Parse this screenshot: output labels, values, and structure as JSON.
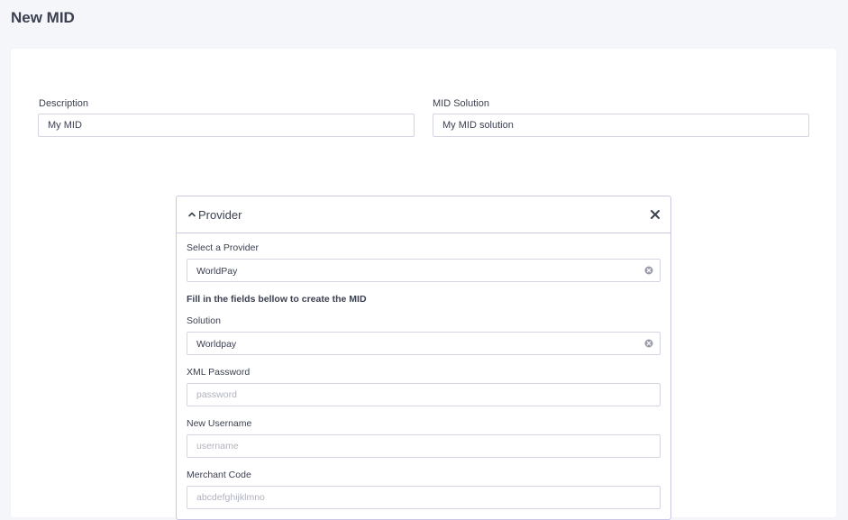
{
  "page": {
    "title": "New MID"
  },
  "form": {
    "description": {
      "label": "Description",
      "value": "My MID"
    },
    "mid_solution": {
      "label": "MID Solution",
      "value": "My MID solution"
    }
  },
  "provider_panel": {
    "title": "Provider",
    "select_provider": {
      "label": "Select a Provider",
      "value": "WorldPay"
    },
    "instructions": "Fill in the fields bellow to create the MID",
    "solution": {
      "label": "Solution",
      "value": "Worldpay"
    },
    "xml_password": {
      "label": "XML Password",
      "placeholder": "password",
      "value": ""
    },
    "new_username": {
      "label": "New Username",
      "placeholder": "username",
      "value": ""
    },
    "merchant_code": {
      "label": "Merchant Code",
      "placeholder": "abcdefghijklmno",
      "value": ""
    }
  },
  "icons": {
    "collapse": "chevron-up-icon",
    "close": "close-icon",
    "clear": "clear-circle-icon"
  },
  "colors": {
    "background": "#f5f6fa",
    "card": "#ffffff",
    "panel_border": "#cbc6e6",
    "input_border": "#d4d5e0",
    "text": "#3c4150",
    "placeholder": "#b0b3bf"
  }
}
